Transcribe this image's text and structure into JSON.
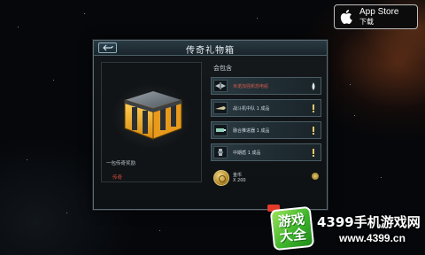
{
  "appstore": {
    "title": "App Store",
    "subtitle": "下载"
  },
  "dialog": {
    "title": "传奇礼物箱",
    "left": {
      "label": "传奇",
      "description": "一包传奇奖励"
    },
    "contains_label": "会包含",
    "items": [
      {
        "name": "米诺加强帆恐电船",
        "icon": "ship-icon",
        "badge": "drop-icon",
        "red": true
      },
      {
        "name": "战斗机中队 1 成品",
        "icon": "fighter-icon",
        "badge": "exclaim-icon",
        "red": false
      },
      {
        "name": "融合推进器 1 成品",
        "icon": "engine-icon",
        "badge": "exclaim-icon",
        "red": false
      },
      {
        "name": "中期盾 1 成品",
        "icon": "shield-module-icon",
        "badge": "exclaim-icon",
        "red": false
      }
    ],
    "currency": {
      "name": "金币",
      "quantity": "X 200",
      "icon": "coin-icon"
    }
  },
  "watermark": {
    "box_line1": "游戏",
    "box_line2": "大全",
    "brand": "4399手机游戏网",
    "url": "www.4399.cn"
  },
  "colors": {
    "accent_red": "#d24a3a",
    "frame": "#5b6a72",
    "gold": "#e6c76a",
    "watermark_green": "#3fb52c"
  }
}
